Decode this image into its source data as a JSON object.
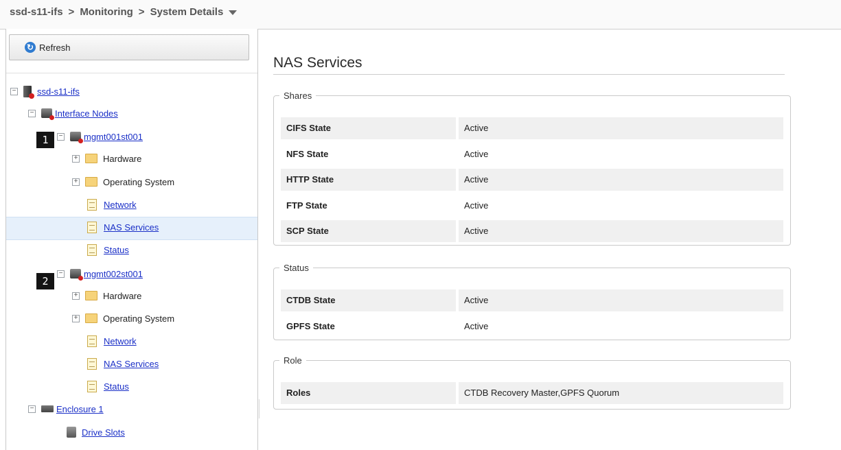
{
  "breadcrumb": {
    "items": [
      "ssd-s11-ifs",
      "Monitoring",
      "System Details"
    ],
    "separator": ">"
  },
  "toolbar": {
    "refresh_label": "Refresh",
    "refresh_icon": "refresh-icon"
  },
  "tree": {
    "root": "ssd-s11-ifs",
    "interface_nodes": "Interface Nodes",
    "node1": {
      "name": "mgmt001st001",
      "hardware": "Hardware",
      "os": "Operating System",
      "network": "Network",
      "nas": "NAS Services",
      "status": "Status"
    },
    "node2": {
      "name": "mgmt002st001",
      "hardware": "Hardware",
      "os": "Operating System",
      "network": "Network",
      "nas": "NAS Services",
      "status": "Status"
    },
    "enclosure": "Enclosure 1",
    "drive_slots": "Drive Slots",
    "selected": "NAS Services"
  },
  "markers": [
    "1",
    "2"
  ],
  "main": {
    "title": "NAS Services",
    "shares": {
      "legend": "Shares",
      "rows": [
        {
          "key": "CIFS State",
          "value": "Active"
        },
        {
          "key": "NFS State",
          "value": "Active"
        },
        {
          "key": "HTTP State",
          "value": "Active"
        },
        {
          "key": "FTP State",
          "value": "Active"
        },
        {
          "key": "SCP State",
          "value": "Active"
        }
      ]
    },
    "status": {
      "legend": "Status",
      "rows": [
        {
          "key": "CTDB State",
          "value": "Active"
        },
        {
          "key": "GPFS State",
          "value": "Active"
        }
      ]
    },
    "role": {
      "legend": "Role",
      "rows": [
        {
          "key": "Roles",
          "value": "CTDB Recovery Master,GPFS Quorum"
        }
      ]
    }
  },
  "colors": {
    "link": "#1a2fc7",
    "selected_row": "#e6f0fb",
    "error_badge": "#d32020"
  }
}
